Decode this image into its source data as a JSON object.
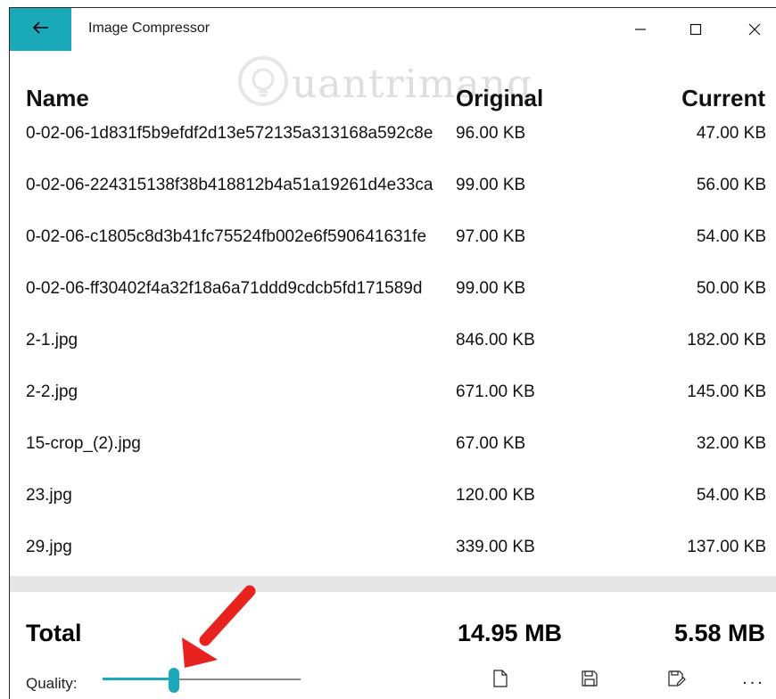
{
  "window": {
    "title": "Image Compressor",
    "back_icon": "back-arrow-icon",
    "accent_color": "#1aa9b8"
  },
  "watermark": {
    "text": "uantrimang"
  },
  "table": {
    "headers": {
      "name": "Name",
      "original": "Original",
      "current": "Current"
    },
    "rows": [
      {
        "name": "0-02-06-1d831f5b9efdf2d13e572135a313168a592c8e",
        "original": "96.00 KB",
        "current": "47.00 KB"
      },
      {
        "name": "0-02-06-224315138f38b418812b4a51a19261d4e33ca",
        "original": "99.00 KB",
        "current": "56.00 KB"
      },
      {
        "name": "0-02-06-c1805c8d3b41fc75524fb002e6f590641631fe",
        "original": "97.00 KB",
        "current": "54.00 KB"
      },
      {
        "name": "0-02-06-ff30402f4a32f18a6a71ddd9cdcb5fd171589d",
        "original": "99.00 KB",
        "current": "50.00 KB"
      },
      {
        "name": "2-1.jpg",
        "original": "846.00 KB",
        "current": "182.00 KB"
      },
      {
        "name": "2-2.jpg",
        "original": "671.00 KB",
        "current": "145.00 KB"
      },
      {
        "name": "15-crop_(2).jpg",
        "original": "67.00 KB",
        "current": "32.00 KB"
      },
      {
        "name": "23.jpg",
        "original": "120.00 KB",
        "current": "54.00 KB"
      },
      {
        "name": "29.jpg",
        "original": "339.00 KB",
        "current": "137.00 KB"
      }
    ]
  },
  "totals": {
    "label": "Total",
    "original": "14.95 MB",
    "current": "5.58 MB"
  },
  "quality": {
    "label": "Quality:",
    "value_fraction": 0.36
  },
  "appbar": {
    "new_icon": "new-file-icon",
    "save_icon": "save-icon",
    "save_as_icon": "save-as-icon",
    "more_label": "..."
  },
  "annotation": {
    "arrow_color": "#e8231f"
  }
}
